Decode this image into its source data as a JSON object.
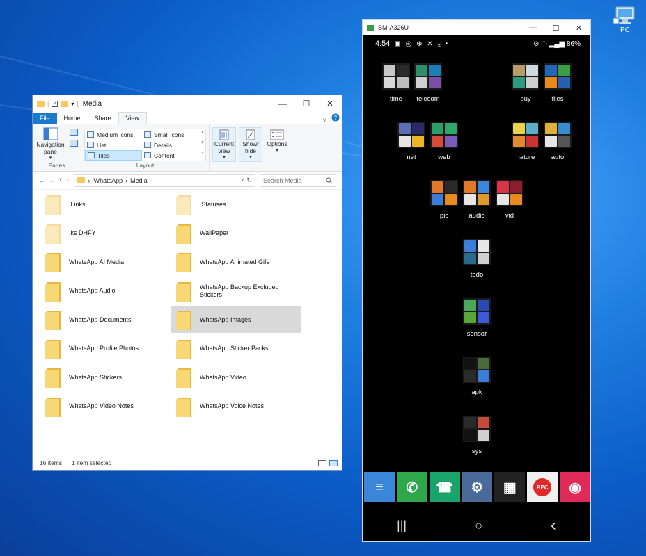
{
  "desktop": {
    "pc_icon_label": "PC"
  },
  "explorer": {
    "window_title": "Media",
    "controls": {
      "minimize": "—",
      "maximize": "☐",
      "close": "✕"
    },
    "tabs": [
      {
        "label": "File"
      },
      {
        "label": "Home"
      },
      {
        "label": "Share"
      },
      {
        "label": "View"
      }
    ],
    "ribbon": {
      "panes_group": {
        "button_label": "Navigation pane",
        "group_label": "Panes"
      },
      "layout_group": {
        "items": [
          "Medium icons",
          "Small icons",
          "List",
          "Details",
          "Tiles",
          "Content"
        ],
        "selected": "Tiles",
        "group_label": "Layout"
      },
      "current_view_label": "Current view",
      "show_hide_label": "Show/ hide",
      "options_label": "Options"
    },
    "address": {
      "prefix": "«",
      "path": [
        "WhatsApp",
        "Media"
      ],
      "search_placeholder": "Search Media"
    },
    "items": [
      {
        "name": ".Links",
        "faded": true
      },
      {
        "name": ".Statuses",
        "faded": true
      },
      {
        "name": ".ks DHFY",
        "faded": true
      },
      {
        "name": "WallPaper",
        "faded": false
      },
      {
        "name": "WhatsApp AI Media",
        "faded": false
      },
      {
        "name": "WhatsApp Animated Gifs",
        "faded": false
      },
      {
        "name": "WhatsApp Audio",
        "faded": false
      },
      {
        "name": "WhatsApp Backup Excluded Stickers",
        "faded": false
      },
      {
        "name": "WhatsApp Documents",
        "faded": false
      },
      {
        "name": "WhatsApp Images",
        "faded": false,
        "selected": true
      },
      {
        "name": "WhatsApp Profile Photos",
        "faded": false
      },
      {
        "name": "WhatsApp Sticker Packs",
        "faded": false
      },
      {
        "name": "WhatsApp Stickers",
        "faded": false
      },
      {
        "name": "WhatsApp Video",
        "faded": false
      },
      {
        "name": "WhatsApp Video Notes",
        "faded": false
      },
      {
        "name": "WhatsApp Voice Notes",
        "faded": false
      }
    ],
    "status": {
      "count": "16 items",
      "selected": "1 item selected"
    }
  },
  "phone": {
    "window_title": "SM-A326U",
    "time": "4:54",
    "battery": "86%",
    "folders": [
      {
        "label": "time",
        "colors": [
          "#c8c8c8",
          "#2b2b2b",
          "#d9d9d9",
          "#bfbfbf"
        ]
      },
      {
        "label": "telecom",
        "colors": [
          "#2f8f6a",
          "#1c7fb8",
          "#cfcfcf",
          "#7a4fa5"
        ]
      },
      {
        "label": "buy",
        "colors": [
          "#b89b6a",
          "#d0d8e0",
          "#2e9b7f",
          "#cfcfcf"
        ]
      },
      {
        "label": "files",
        "colors": [
          "#2466b8",
          "#3b9f4a",
          "#e98a1f",
          "#2a5fb0"
        ]
      },
      {
        "label": "net",
        "colors": [
          "#5a6fb8",
          "#2a2a6a",
          "#e6e6e6",
          "#f0b429"
        ]
      },
      {
        "label": "web",
        "colors": [
          "#2d9d6a",
          "#2fa86a",
          "#d94a3a",
          "#7b5ab8"
        ]
      },
      {
        "label": "nature",
        "colors": [
          "#e9d34a",
          "#5ab0c8",
          "#e0892f",
          "#c33"
        ]
      },
      {
        "label": "auto",
        "colors": [
          "#e0b03a",
          "#3a8ad0",
          "#e6e6e6",
          "#555"
        ]
      },
      {
        "label": "pic",
        "colors": [
          "#e07a2a",
          "#2a2a2a",
          "#3b7dd8",
          "#e98a1f"
        ]
      },
      {
        "label": "audio",
        "colors": [
          "#e0782a",
          "#3b86d8",
          "#e6e6e6",
          "#e09a2a"
        ]
      },
      {
        "label": "vid",
        "colors": [
          "#d9344a",
          "#8a1e2e",
          "#e6e6e6",
          "#e98a1f"
        ]
      },
      {
        "label": "todo",
        "colors": [
          "#3b7dd8",
          "#e6e6e6",
          "#2a6a8a",
          "#cfcfcf"
        ]
      },
      {
        "label": "sensor",
        "colors": [
          "#4aa85a",
          "#2a4ab8",
          "#5aa83a",
          "#3b5ad8"
        ]
      },
      {
        "label": "apk",
        "colors": [
          "#111111",
          "#4a6a3a",
          "#2a2a2a",
          "#3b7dd8"
        ]
      },
      {
        "label": "sys",
        "colors": [
          "#2a2a2a",
          "#c84a3a",
          "#111111",
          "#cfcfcf"
        ]
      }
    ],
    "dock": [
      {
        "name": "messages",
        "glyph": "≡",
        "color": "#3b86d8"
      },
      {
        "name": "whatsapp",
        "glyph": "✆",
        "color": "#2ea84a"
      },
      {
        "name": "phone",
        "glyph": "☎",
        "color": "#1aa36a"
      },
      {
        "name": "settings",
        "glyph": "⚙",
        "color": "#4a6a9a"
      },
      {
        "name": "quick-folder",
        "glyph": "▦",
        "color": "#222222"
      },
      {
        "name": "recorder",
        "glyph": "REC",
        "color": "#f0f0f0"
      },
      {
        "name": "camera",
        "glyph": "◉",
        "color": "#e02a5a"
      }
    ],
    "nav": {
      "recents": "|||",
      "home": "○",
      "back": "‹"
    }
  }
}
